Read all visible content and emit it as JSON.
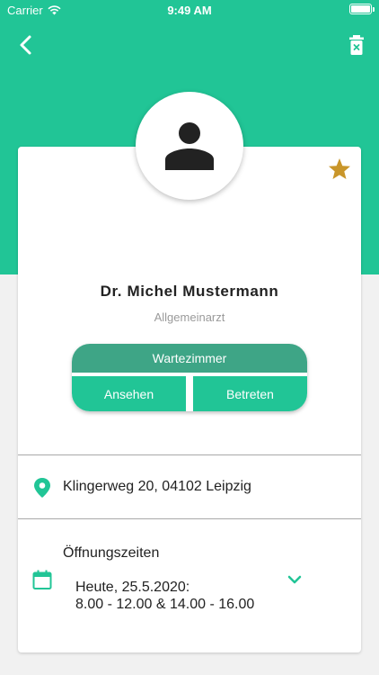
{
  "status_bar": {
    "carrier": "Carrier",
    "time": "9:49 AM"
  },
  "header": {
    "back_icon": "chevron-left-icon",
    "delete_icon": "trash-icon",
    "background_color": "#21c596"
  },
  "profile": {
    "favorite_icon": "star-icon",
    "favorite_color": "#c9962a",
    "avatar_icon": "person-icon",
    "name": "Dr. Michel Mustermann",
    "specialty": "Allgemeinarzt"
  },
  "waiting_room": {
    "title": "Wartezimmer",
    "view_label": "Ansehen",
    "enter_label": "Betreten"
  },
  "address": {
    "icon": "location-pin-icon",
    "text": "Klingerweg 20, 04102 Leipzig"
  },
  "opening_hours": {
    "title": "Öffnungszeiten",
    "icon": "calendar-icon",
    "day_line": "Heute, 25.5.2020:",
    "time_line": "8.00 - 12.00 & 14.00 - 16.00",
    "expand_icon": "chevron-down-icon"
  }
}
